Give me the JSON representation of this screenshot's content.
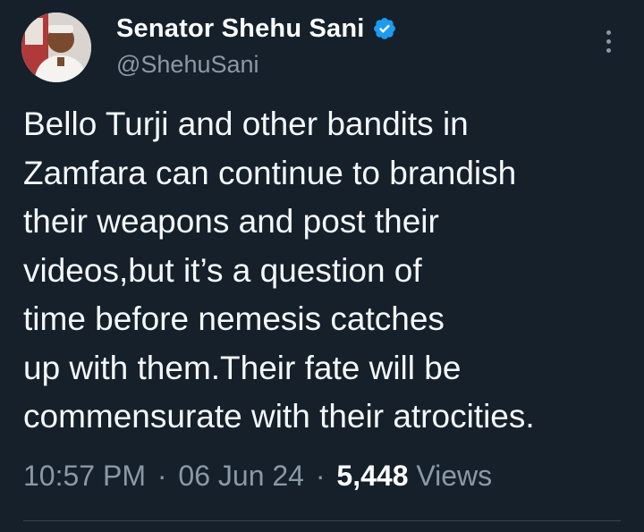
{
  "author": {
    "display_name": "Senator Shehu Sani",
    "handle": "@ShehuSani",
    "verified": true,
    "avatar_icon": "profile-photo"
  },
  "tweet": {
    "lines": [
      "Bello Turji and other bandits in",
      "Zamfara can continue to brandish",
      "their weapons and post their",
      "videos,but it’s a question of",
      "time before nemesis catches",
      "up with them.Their fate will be",
      "commensurate with their atrocities."
    ]
  },
  "meta": {
    "time": "10:57 PM",
    "separator": "·",
    "date": "06 Jun 24",
    "views_count": "5,448",
    "views_label": "Views"
  },
  "colors": {
    "background": "#15202b",
    "text": "#ffffff",
    "secondary_text": "#8b98a5",
    "verified_badge": "#1d9bf0",
    "divider": "#38444d"
  },
  "icons": {
    "verified": "verified-badge-icon",
    "more": "more-options-icon"
  }
}
